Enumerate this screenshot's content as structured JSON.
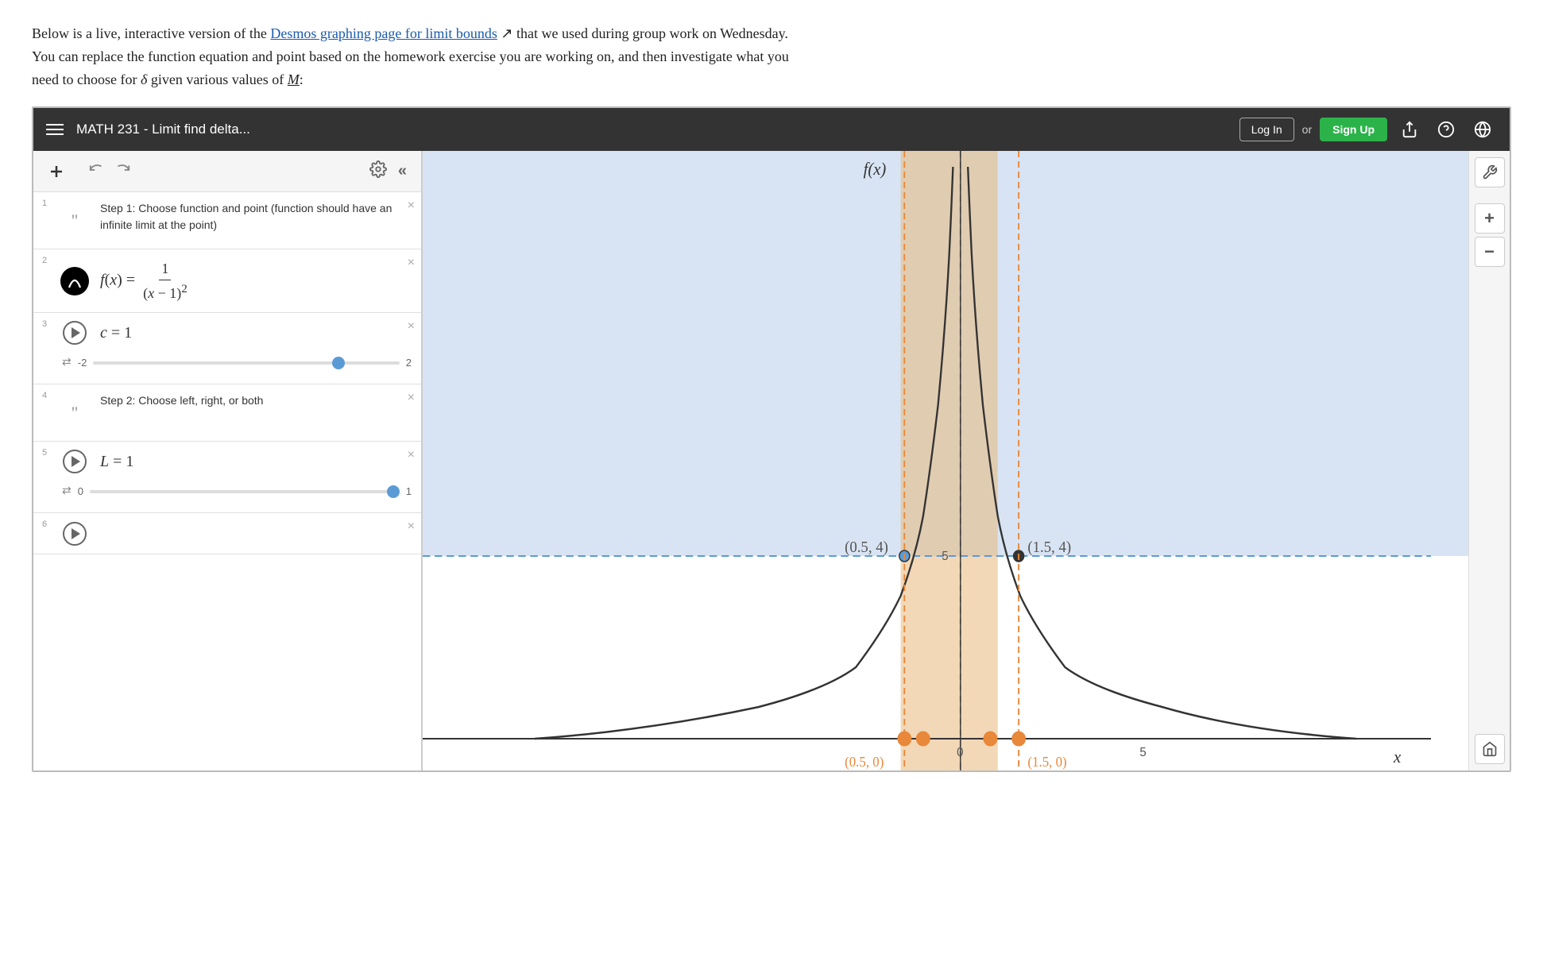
{
  "intro": {
    "text1": "Below is a live, interactive version of the ",
    "link_text": "Desmos graphing page for limit bounds",
    "text2": " that we used during group work on Wednesday.",
    "text3": "You can replace the function equation and point based on the homework exercise you are working on, and then investigate what you",
    "text4": "need to choose for ",
    "delta": "δ",
    "text5": " given various values of ",
    "M": "M",
    "text6": ":"
  },
  "header": {
    "title": "MATH 231 - Limit find delta...",
    "login_label": "Log In",
    "or_label": "or",
    "signup_label": "Sign Up"
  },
  "toolbar": {
    "add_label": "+",
    "undo_label": "↩",
    "redo_label": "↪"
  },
  "expressions": [
    {
      "num": "1",
      "type": "note",
      "text": "Step 1: Choose function and point (function should have an infinite limit at the point)"
    },
    {
      "num": "2",
      "type": "function",
      "expr_text": "f(x) = 1 / (x-1)²"
    },
    {
      "num": "3",
      "type": "slider",
      "expr_text": "c = 1",
      "slider_min": "-2",
      "slider_max": "2",
      "slider_val": 0.75
    },
    {
      "num": "4",
      "type": "note",
      "text": "Step 2: Choose left, right, or both"
    },
    {
      "num": "5",
      "type": "slider",
      "expr_text": "L = 1",
      "slider_min": "0",
      "slider_max": "1",
      "slider_val": 1.0
    },
    {
      "num": "6",
      "type": "partial"
    }
  ],
  "graph": {
    "fx_label": "f(x)",
    "x_label": "x",
    "point1_label": "(0.5, 4)",
    "point2_label": "(1.5, 4)",
    "point3_label": "(0.5, 0)",
    "point4_label": "(1.5, 0)",
    "axis_label_5": "5",
    "axis_label_0": "0"
  },
  "right_toolbar": {
    "wrench_icon": "🔧",
    "plus_icon": "+",
    "minus_icon": "−",
    "home_icon": "⌂"
  }
}
